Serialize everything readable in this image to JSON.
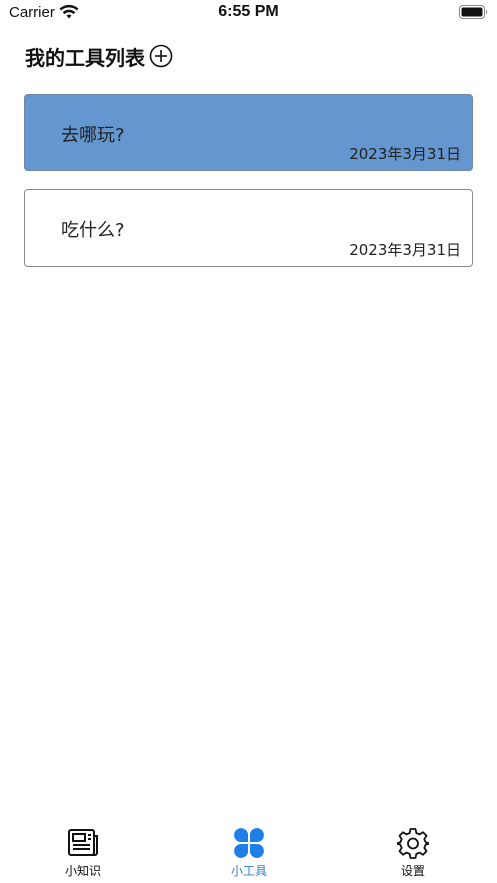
{
  "status": {
    "carrier": "Carrier",
    "time": "6:55 PM"
  },
  "header": {
    "title": "我的工具列表"
  },
  "items": [
    {
      "name": "去哪玩?",
      "date": "2023年3月31日",
      "selected": true
    },
    {
      "name": "吃什么?",
      "date": "2023年3月31日",
      "selected": false
    }
  ],
  "tabs": [
    {
      "label": "小知识",
      "icon": "newspaper-icon"
    },
    {
      "label": "小工具",
      "icon": "clover-icon",
      "selected": true
    },
    {
      "label": "设置",
      "icon": "gear-icon"
    }
  ],
  "colors": {
    "accent": "#2f80d6",
    "selected_card": "#6496cf"
  }
}
